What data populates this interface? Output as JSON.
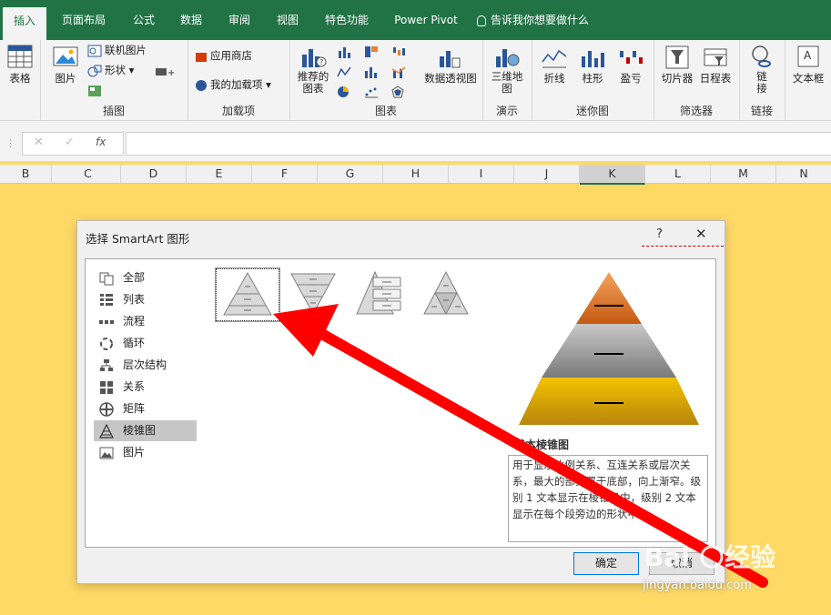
{
  "ribbon": {
    "tabs": [
      {
        "label": "插入",
        "active": true
      },
      {
        "label": "页面布局"
      },
      {
        "label": "公式"
      },
      {
        "label": "数据"
      },
      {
        "label": "审阅"
      },
      {
        "label": "视图"
      },
      {
        "label": "特色功能"
      },
      {
        "label": "Power Pivot"
      }
    ],
    "tell_me": "告诉我你想要做什么",
    "groups": {
      "table": {
        "label": "表格"
      },
      "illustrations": {
        "label": "插图",
        "picture": "图片",
        "online_picture": "联机图片",
        "shapes": "形状"
      },
      "addins": {
        "label": "加载项",
        "store": "应用商店",
        "my_addins": "我的加载项"
      },
      "charts": {
        "label": "图表",
        "recommended": "推荐的\n图表",
        "pivot_chart": "数据透视图"
      },
      "tours": {
        "label": "演示",
        "map3d": "三维地\n图"
      },
      "sparklines": {
        "label": "迷你图",
        "line": "折线",
        "column": "柱形",
        "winloss": "盈亏"
      },
      "filters": {
        "label": "筛选器",
        "slicer": "切片器",
        "timeline": "日程表"
      },
      "links": {
        "label": "链接",
        "link": "链\n接"
      },
      "text": {
        "textbox": "文本框"
      }
    }
  },
  "columns": [
    "B",
    "C",
    "D",
    "E",
    "F",
    "G",
    "H",
    "I",
    "J",
    "K",
    "L",
    "M",
    "N"
  ],
  "selected_column": "K",
  "dialog": {
    "title": "选择 SmartArt 图形",
    "help": "?",
    "close": "✕",
    "categories": [
      {
        "label": "全部",
        "icon": "all-icon"
      },
      {
        "label": "列表",
        "icon": "list-icon"
      },
      {
        "label": "流程",
        "icon": "process-icon"
      },
      {
        "label": "循环",
        "icon": "cycle-icon"
      },
      {
        "label": "层次结构",
        "icon": "hierarchy-icon"
      },
      {
        "label": "关系",
        "icon": "relationship-icon"
      },
      {
        "label": "矩阵",
        "icon": "matrix-icon"
      },
      {
        "label": "棱锥图",
        "icon": "pyramid-icon",
        "selected": true
      },
      {
        "label": "图片",
        "icon": "picture-icon"
      }
    ],
    "preview": {
      "name": "基本棱锥图",
      "description": "用于显示比例关系、互连关系或层次关系，最大的部分置于底部，向上渐窄。级别 1 文本显示在棱锥段中，级别 2 文本显示在每个段旁边的形状中。"
    },
    "ok": "确定",
    "cancel": "取消"
  },
  "watermark": "jingyan.baidu.com",
  "colors": {
    "accent": "#217346",
    "background": "#ffd966",
    "arrow": "#ff0000"
  }
}
